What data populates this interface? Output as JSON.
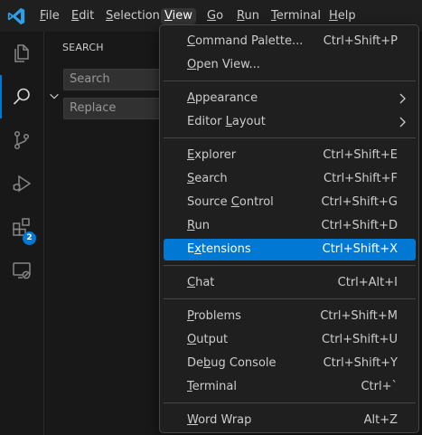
{
  "menubar": {
    "items": [
      {
        "label": "File",
        "mnemonic": "F",
        "rest": "ile"
      },
      {
        "label": "Edit",
        "mnemonic": "E",
        "rest": "dit"
      },
      {
        "label": "Selection",
        "mnemonic": "S",
        "rest": "election"
      },
      {
        "label": "View",
        "mnemonic": "V",
        "rest": "iew"
      },
      {
        "label": "Go",
        "mnemonic": "G",
        "rest": "o"
      },
      {
        "label": "Run",
        "mnemonic": "R",
        "rest": "un"
      },
      {
        "label": "Terminal",
        "mnemonic": "T",
        "rest": "erminal"
      },
      {
        "label": "Help",
        "mnemonic": "H",
        "rest": "elp"
      }
    ],
    "active": "View"
  },
  "activitybar": {
    "extensions_badge": "2"
  },
  "sidebar": {
    "title": "SEARCH",
    "search_placeholder": "Search",
    "replace_placeholder": "Replace"
  },
  "view_menu": {
    "items": [
      {
        "pre": "",
        "mn": "C",
        "post": "ommand Palette...",
        "shortcut": "Ctrl+Shift+P"
      },
      {
        "pre": "",
        "mn": "O",
        "post": "pen View...",
        "shortcut": ""
      },
      {
        "pre": "",
        "mn": "A",
        "post": "ppearance",
        "shortcut": ""
      },
      {
        "pre": "Editor ",
        "mn": "L",
        "post": "ayout",
        "shortcut": ""
      },
      {
        "pre": "",
        "mn": "E",
        "post": "xplorer",
        "shortcut": "Ctrl+Shift+E"
      },
      {
        "pre": "",
        "mn": "S",
        "post": "earch",
        "shortcut": "Ctrl+Shift+F"
      },
      {
        "pre": "Source ",
        "mn": "C",
        "post": "ontrol",
        "shortcut": "Ctrl+Shift+G"
      },
      {
        "pre": "",
        "mn": "R",
        "post": "un",
        "shortcut": "Ctrl+Shift+D"
      },
      {
        "pre": "E",
        "mn": "x",
        "post": "tensions",
        "shortcut": "Ctrl+Shift+X"
      },
      {
        "pre": "",
        "mn": "C",
        "post": "hat",
        "shortcut": "Ctrl+Alt+I"
      },
      {
        "pre": "",
        "mn": "P",
        "post": "roblems",
        "shortcut": "Ctrl+Shift+M"
      },
      {
        "pre": "",
        "mn": "O",
        "post": "utput",
        "shortcut": "Ctrl+Shift+U"
      },
      {
        "pre": "De",
        "mn": "b",
        "post": "ug Console",
        "shortcut": "Ctrl+Shift+Y"
      },
      {
        "pre": "",
        "mn": "T",
        "post": "erminal",
        "shortcut": "Ctrl+`"
      },
      {
        "pre": "",
        "mn": "W",
        "post": "ord Wrap",
        "shortcut": "Alt+Z"
      }
    ],
    "highlighted_item": "Extensions"
  },
  "colors": {
    "accent": "#0078d4",
    "menu_background": "#1f1f1f",
    "workbench_background": "#181818"
  }
}
